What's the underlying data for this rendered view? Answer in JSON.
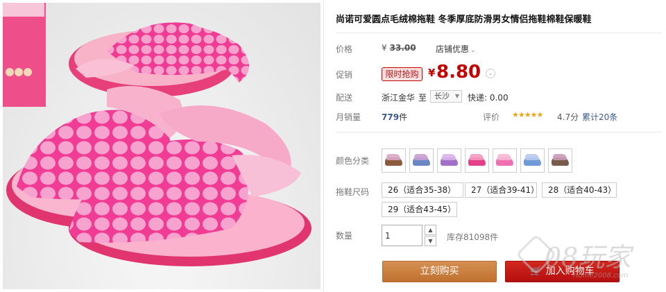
{
  "product": {
    "title": "尚诺可爱圆点毛绒棉拖鞋 冬季厚底防滑男女情侣拖鞋棉鞋保暖鞋",
    "image_alt": "pink polka dot plush slippers"
  },
  "price": {
    "label": "价格",
    "currency": "¥",
    "original": "33.00",
    "shop_promo": "店铺优惠"
  },
  "promo": {
    "label": "促销",
    "badge": "限时抢购",
    "currency": "¥",
    "price": "8.80"
  },
  "shipping": {
    "label": "配送",
    "from": "浙江金华",
    "to_word": "至",
    "city": "长沙",
    "express": "快递: 0.00"
  },
  "sales": {
    "label": "月销量",
    "count": "779",
    "unit": "件",
    "rating_label": "评价",
    "stars": "★★★★★",
    "score": "4.7分",
    "reviews": "累计20条"
  },
  "colors": {
    "label": "颜色分类",
    "swatches": [
      {
        "name": "brown",
        "color": "#8b5a3c",
        "top": "#d9a7c7"
      },
      {
        "name": "blue",
        "color": "#6a86c4",
        "top": "#c9a0d0"
      },
      {
        "name": "purple",
        "color": "#a46fc8",
        "top": "#d9b3e8"
      },
      {
        "name": "rose",
        "color": "#e4408a",
        "top": "#f59ac2"
      },
      {
        "name": "pink",
        "color": "#f06fb0",
        "top": "#f8b7d6"
      },
      {
        "name": "sky",
        "color": "#6f9ad8",
        "top": "#b8c9ee"
      },
      {
        "name": "coffee",
        "color": "#7a5a4a",
        "top": "#c99ab8"
      }
    ]
  },
  "sizes": {
    "label": "拖鞋尺码",
    "options": [
      "26（适合35-38）",
      "27（适合39-41）",
      "28（适合40-43）",
      "29（适合43-45）"
    ]
  },
  "quantity": {
    "label": "数量",
    "value": "1",
    "stock": "库存81098件"
  },
  "actions": {
    "buy_now": "立刻购买",
    "add_to_cart": "加入购物车"
  },
  "watermark": {
    "brand": "08玩家",
    "domain": "Home2008.com"
  }
}
